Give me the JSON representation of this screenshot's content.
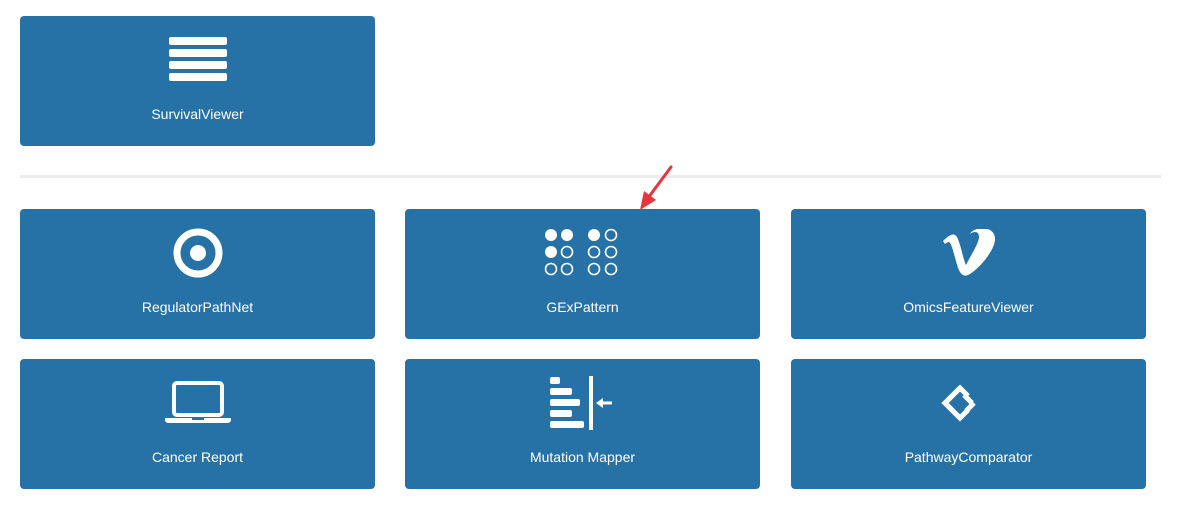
{
  "colors": {
    "tile_background": "#2672a6",
    "tile_text": "#ffffff",
    "divider": "#ececec",
    "annotation_arrow": "#e8343a"
  },
  "top_section": {
    "tiles": [
      {
        "label": "SurvivalViewer",
        "icon": "list-lines-icon"
      }
    ]
  },
  "grid_section": {
    "tiles": [
      {
        "label": "RegulatorPathNet",
        "icon": "target-icon"
      },
      {
        "label": "GExPattern",
        "icon": "dots-grid-icon"
      },
      {
        "label": "OmicsFeatureViewer",
        "icon": "vimeo-icon"
      },
      {
        "label": "Cancer Report",
        "icon": "laptop-icon"
      },
      {
        "label": "Mutation Mapper",
        "icon": "bars-align-arrow-icon"
      },
      {
        "label": "PathwayComparator",
        "icon": "linked-diamonds-icon"
      }
    ]
  },
  "annotation": {
    "icon": "red-arrow-icon",
    "points_to": "GExPattern"
  }
}
